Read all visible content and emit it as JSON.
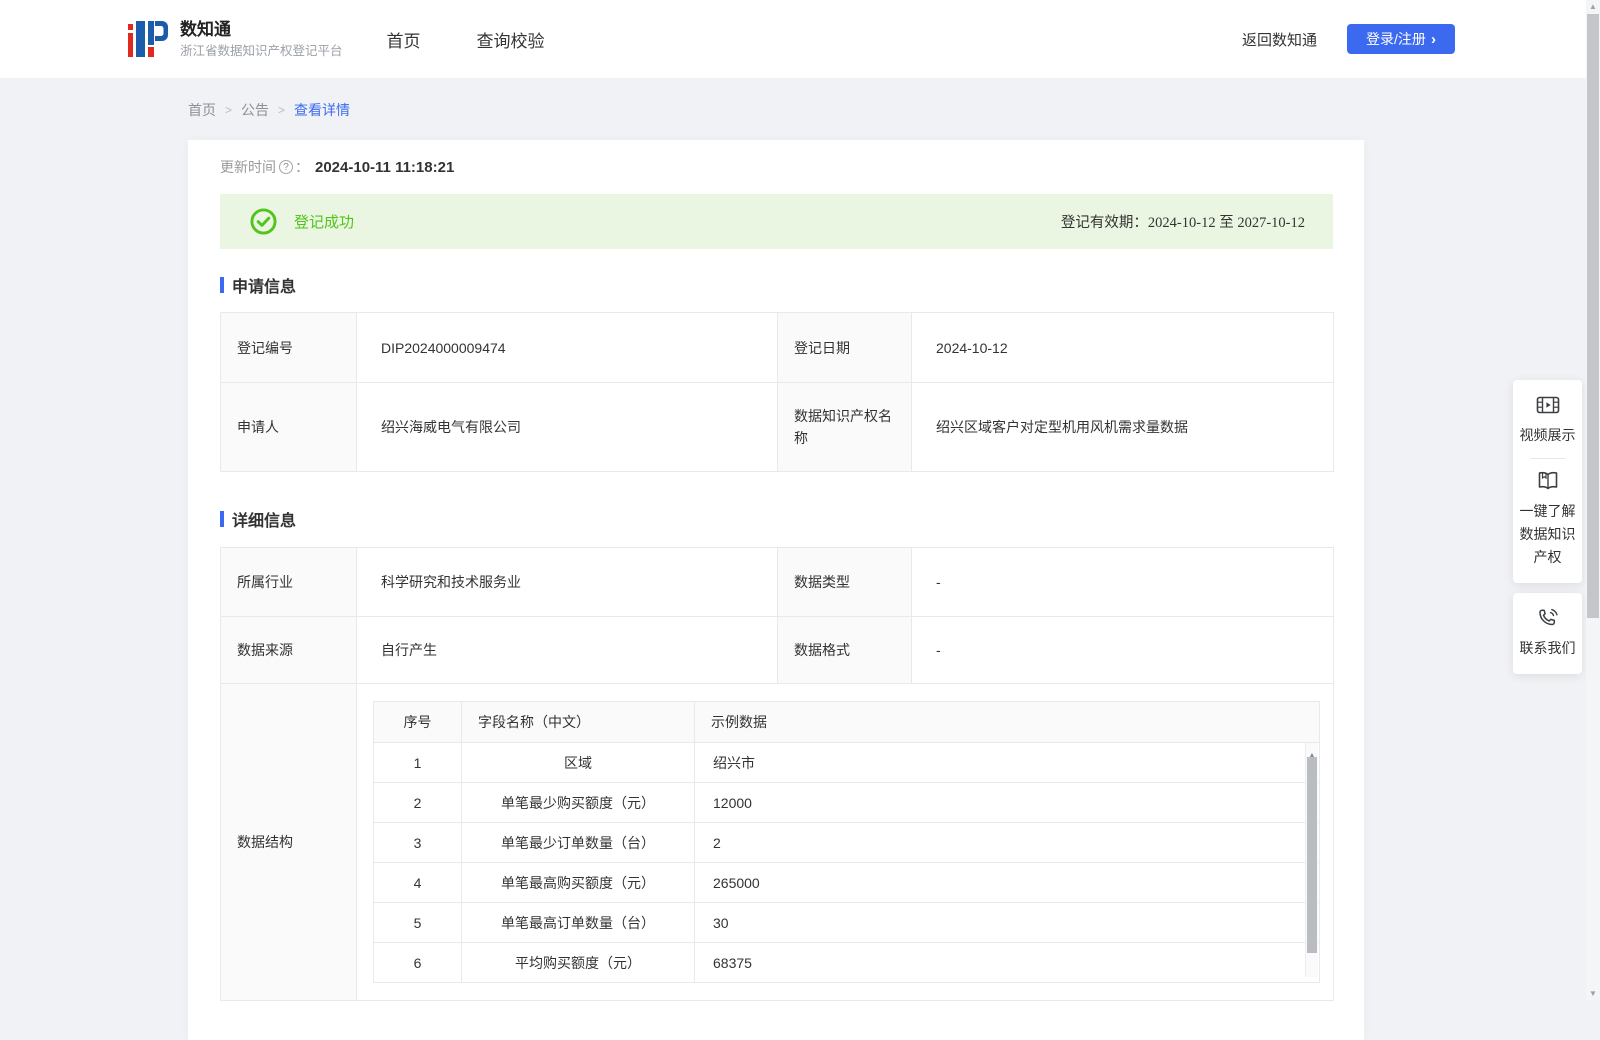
{
  "header": {
    "brand": {
      "title": "数知通",
      "subtitle": "浙江省数据知识产权登记平台"
    },
    "nav": {
      "home": "首页",
      "verify": "查询校验"
    },
    "back_link": "返回数知通",
    "login": {
      "label": "登录/注册",
      "chevron": "›"
    }
  },
  "breadcrumb": {
    "home": "首页",
    "sep": ">",
    "announcement": "公告",
    "current": "查看详情"
  },
  "update_time": {
    "label": "更新时间",
    "help": "?",
    "colon": "：",
    "value": "2024-10-11 11:18:21"
  },
  "status_banner": {
    "status": "登记成功",
    "validity_label": "登记有效期：",
    "validity_value": "2024-10-12 至 2027-10-12"
  },
  "sections": {
    "application": "申请信息",
    "details": "详细信息"
  },
  "application_info": {
    "reg_no_label": "登记编号",
    "reg_no": "DIP2024000009474",
    "reg_date_label": "登记日期",
    "reg_date": "2024-10-12",
    "applicant_label": "申请人",
    "applicant": "绍兴海威电气有限公司",
    "dip_name_label": "数据知识产权名称",
    "dip_name": "绍兴区域客户对定型机用风机需求量数据"
  },
  "detail_info": {
    "industry_label": "所属行业",
    "industry": "科学研究和技术服务业",
    "data_type_label": "数据类型",
    "data_type": "-",
    "data_source_label": "数据来源",
    "data_source": "自行产生",
    "data_format_label": "数据格式",
    "data_format": "-",
    "structure_label": "数据结构"
  },
  "data_structure": {
    "columns": {
      "no": "序号",
      "field": "字段名称（中文）",
      "sample": "示例数据"
    },
    "rows": [
      {
        "no": "1",
        "field": "区域",
        "sample": "绍兴市"
      },
      {
        "no": "2",
        "field": "单笔最少购买额度（元）",
        "sample": "12000"
      },
      {
        "no": "3",
        "field": "单笔最少订单数量（台）",
        "sample": "2"
      },
      {
        "no": "4",
        "field": "单笔最高购买额度（元）",
        "sample": "265000"
      },
      {
        "no": "5",
        "field": "单笔最高订单数量（台）",
        "sample": "30"
      },
      {
        "no": "6",
        "field": "平均购买额度（元）",
        "sample": "68375"
      }
    ]
  },
  "floating_panel": {
    "video": "视频展示",
    "guide": "一键了解数据知识产权",
    "contact": "联系我们"
  },
  "colors": {
    "accent_blue": "#3b6af0",
    "success_green": "#52c41a",
    "banner_bg": "#eaf6e2",
    "label_cell_bg": "#fafafa",
    "border": "#e9e9e9",
    "page_bg": "#f1f2f5",
    "logo_red": "#e02a1f",
    "logo_blue": "#1b5cab"
  }
}
